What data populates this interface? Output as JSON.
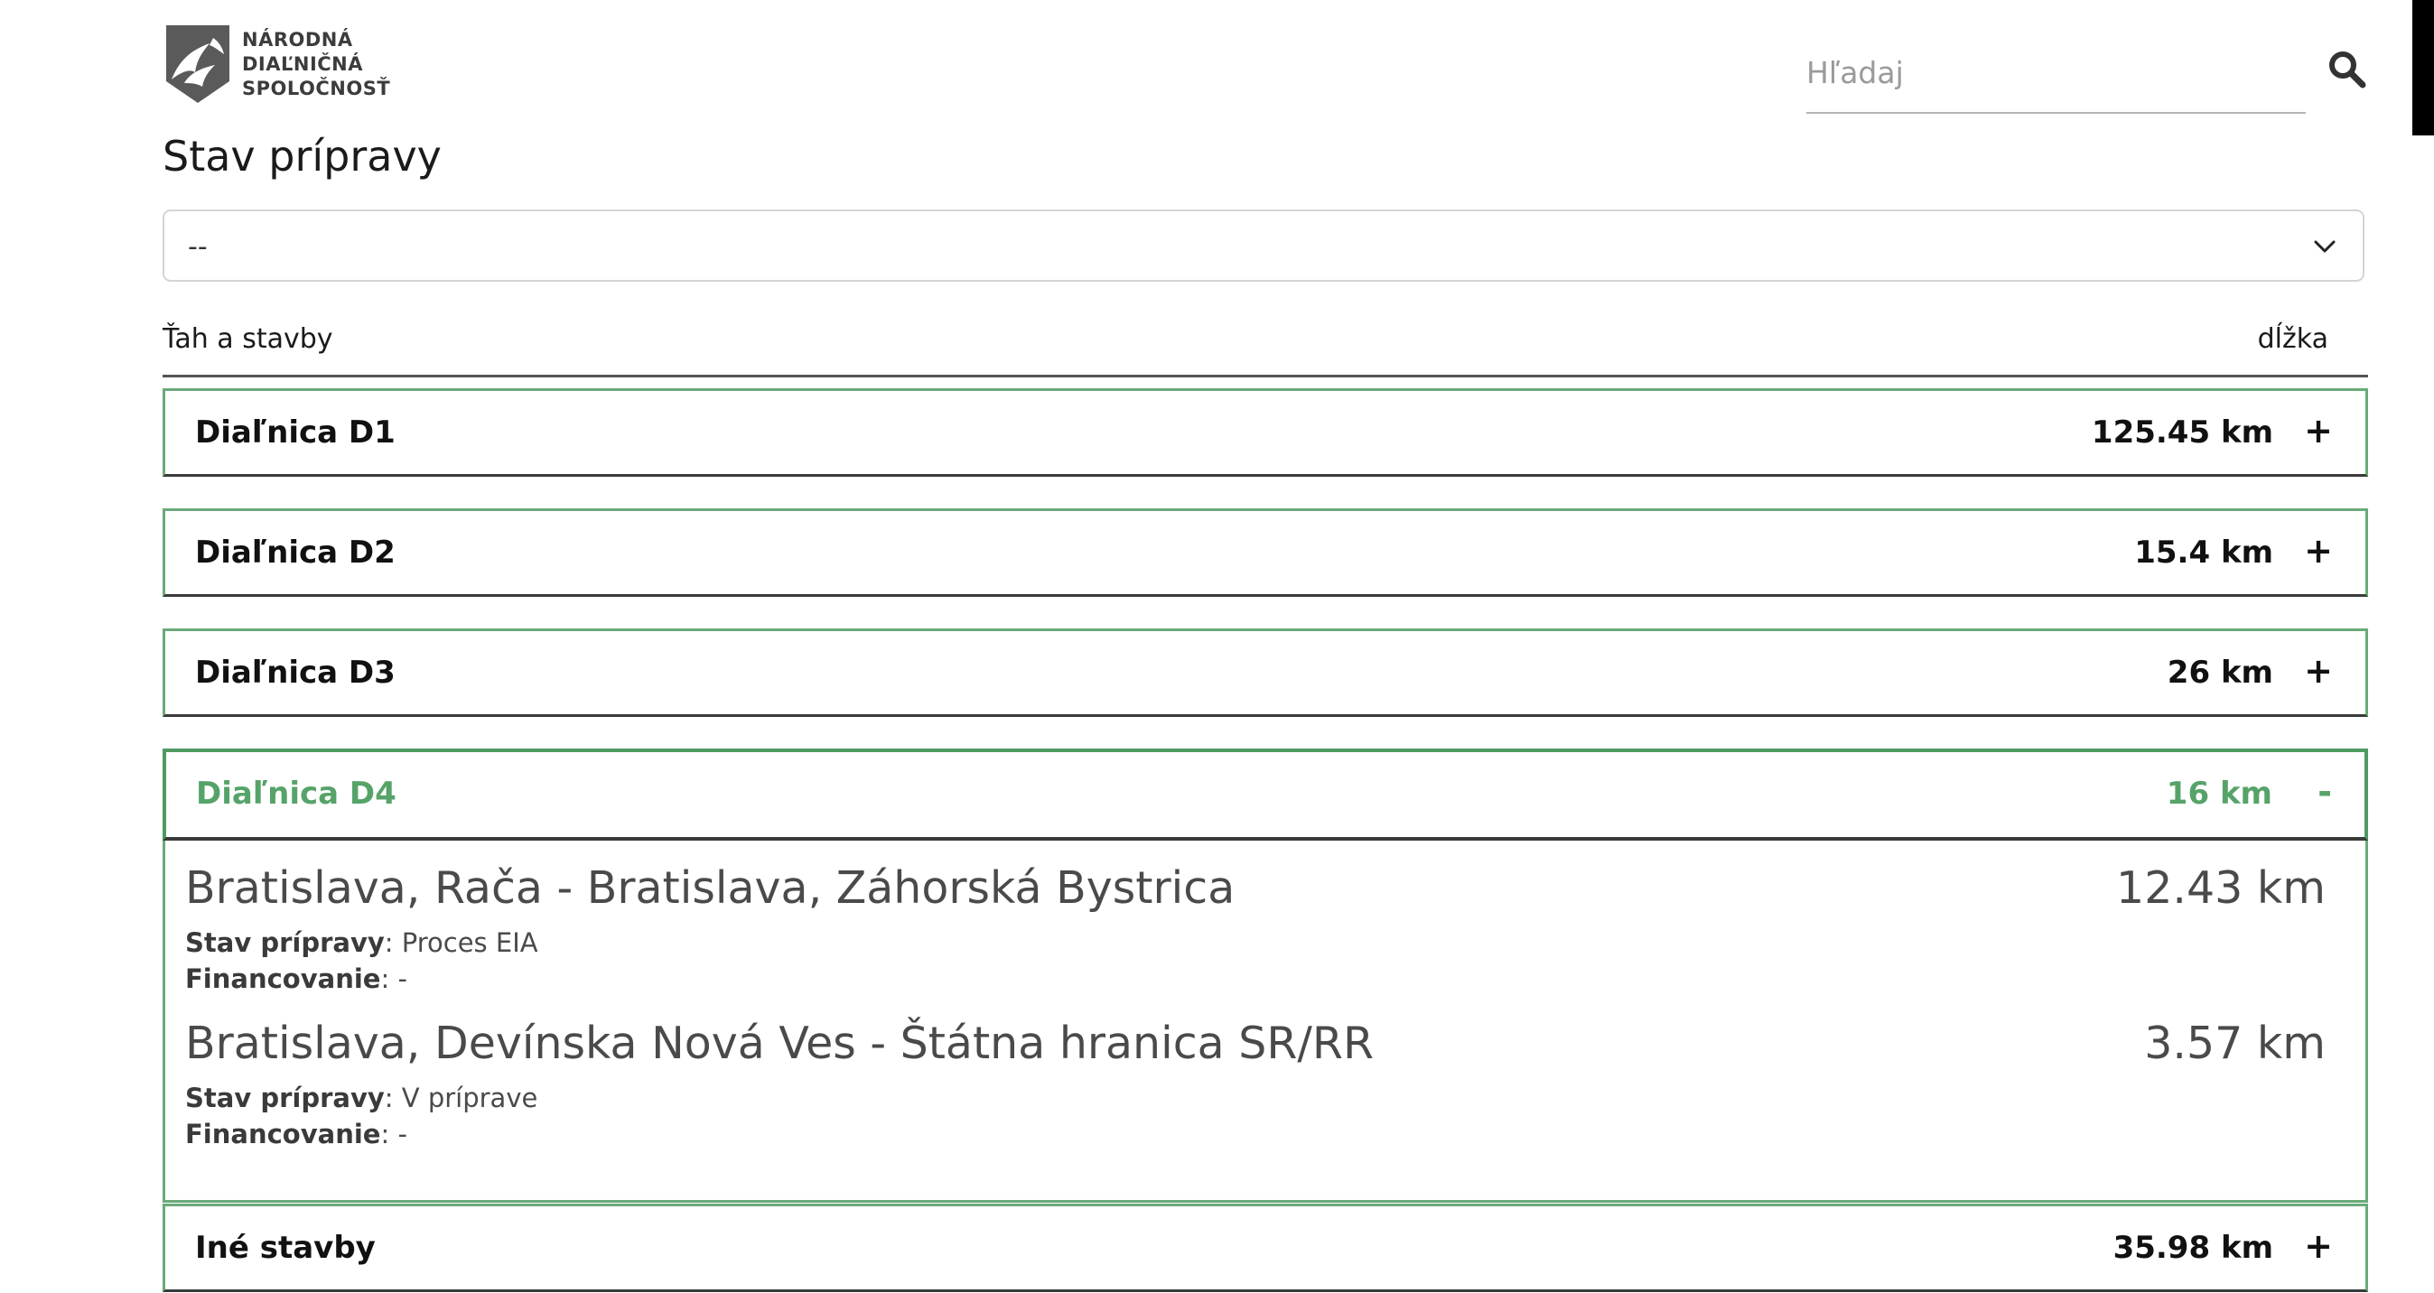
{
  "logo": {
    "lines": [
      "NÁRODNÁ",
      "DIAĽNIČNÁ",
      "SPOLOČNOSŤ"
    ],
    "mark_icon": "ndsh-road-logo-icon"
  },
  "search": {
    "placeholder": "Hľadaj",
    "value": "",
    "icon": "search-icon"
  },
  "page_title": "Stav prípravy",
  "filter": {
    "selected": "--",
    "icon": "chevron-down-icon"
  },
  "table": {
    "col_left": "Ťah a stavby",
    "col_right": "dĺžka"
  },
  "labels": {
    "status": "Stav prípravy",
    "funding": "Financovanie"
  },
  "groups": [
    {
      "name": "Diaľnica D1",
      "length": "125.45 km",
      "toggle": "+",
      "expanded": false
    },
    {
      "name": "Diaľnica D2",
      "length": "15.4 km",
      "toggle": "+",
      "expanded": false
    },
    {
      "name": "Diaľnica D3",
      "length": "26 km",
      "toggle": "+",
      "expanded": false
    },
    {
      "name": "Diaľnica D4",
      "length": "16 km",
      "toggle": "-",
      "expanded": true,
      "projects": [
        {
          "name": "Bratislava, Rača - Bratislava, Záhorská Bystrica",
          "length": "12.43 km",
          "status": "Proces EIA",
          "funding": "-"
        },
        {
          "name": "Bratislava, Devínska Nová Ves - Štátna hranica SR/RR",
          "length": "3.57 km",
          "status": "V príprave",
          "funding": "-"
        }
      ]
    },
    {
      "name": "Iné stavby",
      "length": "35.98 km",
      "toggle": "+",
      "expanded": false
    }
  ],
  "colors": {
    "accent_green": "#56a369",
    "border_green": "#6aaa7a",
    "text_dark": "#111111",
    "text_muted": "#4a4a4a"
  }
}
